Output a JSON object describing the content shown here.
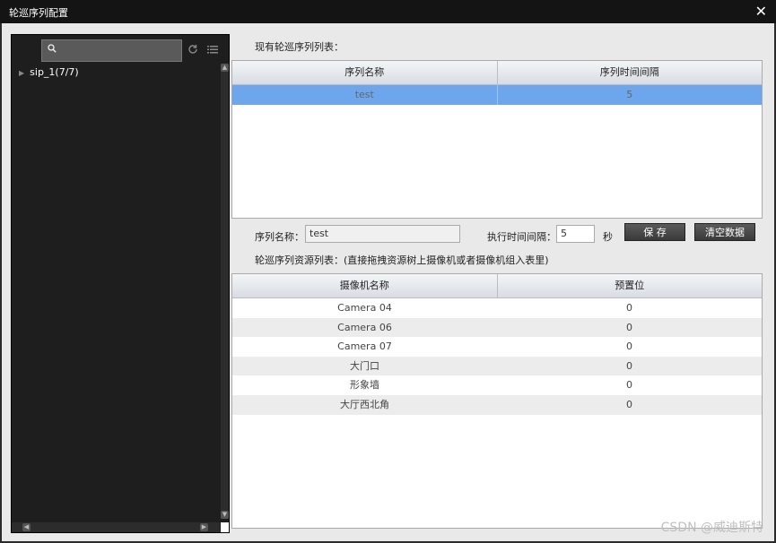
{
  "window": {
    "title": "轮巡序列配置",
    "close_icon": "✕"
  },
  "tree": {
    "search_placeholder": "",
    "root_item": "sip_1(7/7)"
  },
  "sequence_list": {
    "label": "现有轮巡序列列表：",
    "columns": [
      "序列名称",
      "序列时间间隔"
    ],
    "rows": [
      {
        "name": "test",
        "interval": "5"
      }
    ]
  },
  "form": {
    "name_label": "序列名称：",
    "name_value": "test",
    "interval_label": "执行时间间隔：",
    "interval_value": "5",
    "interval_unit": "秒",
    "save_button": "保 存",
    "clear_button": "清空数据"
  },
  "resource_list": {
    "label": "轮巡序列资源列表：(直接拖拽资源树上摄像机或者摄像机组入表里)",
    "columns": [
      "摄像机名称",
      "预置位"
    ],
    "rows": [
      {
        "camera": "Camera 04",
        "preset": "0"
      },
      {
        "camera": "Camera 06",
        "preset": "0"
      },
      {
        "camera": "Camera 07",
        "preset": "0"
      },
      {
        "camera": "大门口",
        "preset": "0"
      },
      {
        "camera": "形象墙",
        "preset": "0"
      },
      {
        "camera": "大厅西北角",
        "preset": "0"
      }
    ]
  },
  "watermark": "CSDN @威迪斯特"
}
